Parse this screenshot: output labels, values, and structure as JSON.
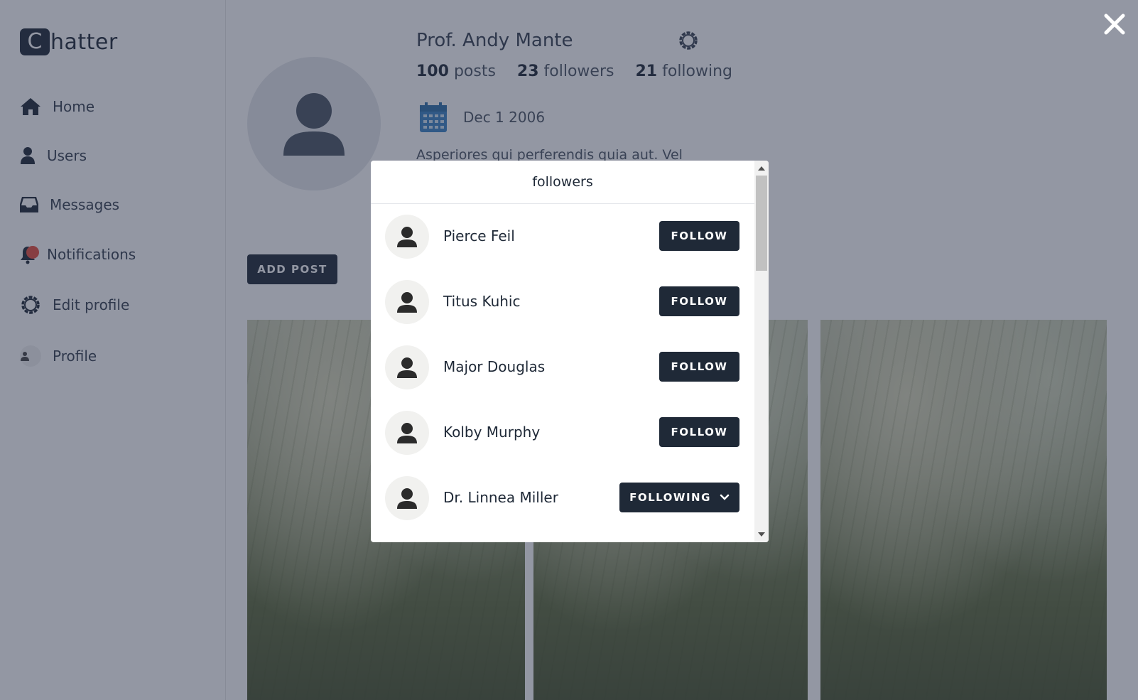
{
  "app": {
    "logo_letter": "C",
    "logo_rest": "hatter"
  },
  "sidebar": {
    "items": [
      {
        "label": "Home",
        "icon": "home-icon"
      },
      {
        "label": "Users",
        "icon": "user-icon"
      },
      {
        "label": "Messages",
        "icon": "inbox-icon"
      },
      {
        "label": "Notifications",
        "icon": "bell-icon"
      },
      {
        "label": "Edit profile",
        "icon": "gear-icon"
      },
      {
        "label": "Profile",
        "icon": "avatar-icon"
      }
    ]
  },
  "profile": {
    "name": "Prof. Andy Mante",
    "posts_count": "100",
    "posts_label": "posts",
    "followers_count": "23",
    "followers_label": "followers",
    "following_count": "21",
    "following_label": "following",
    "joined": "Dec 1 2006",
    "bio": "Asperiores qui perferendis quia aut. Vel",
    "add_post_label": "ADD POST"
  },
  "modal": {
    "title": "followers",
    "users": [
      {
        "name": "Pierce Feil",
        "action": "FOLLOW"
      },
      {
        "name": "Titus Kuhic",
        "action": "FOLLOW"
      },
      {
        "name": "Major Douglas",
        "action": "FOLLOW"
      },
      {
        "name": "Kolby Murphy",
        "action": "FOLLOW"
      },
      {
        "name": "Dr. Linnea Miller",
        "action": "FOLLOWING"
      }
    ]
  },
  "colors": {
    "primary": "#1f2937",
    "overlay": "rgba(40,48,72,0.5)",
    "notification_dot": "#e74c3c",
    "calendar": "#3b82c4"
  }
}
